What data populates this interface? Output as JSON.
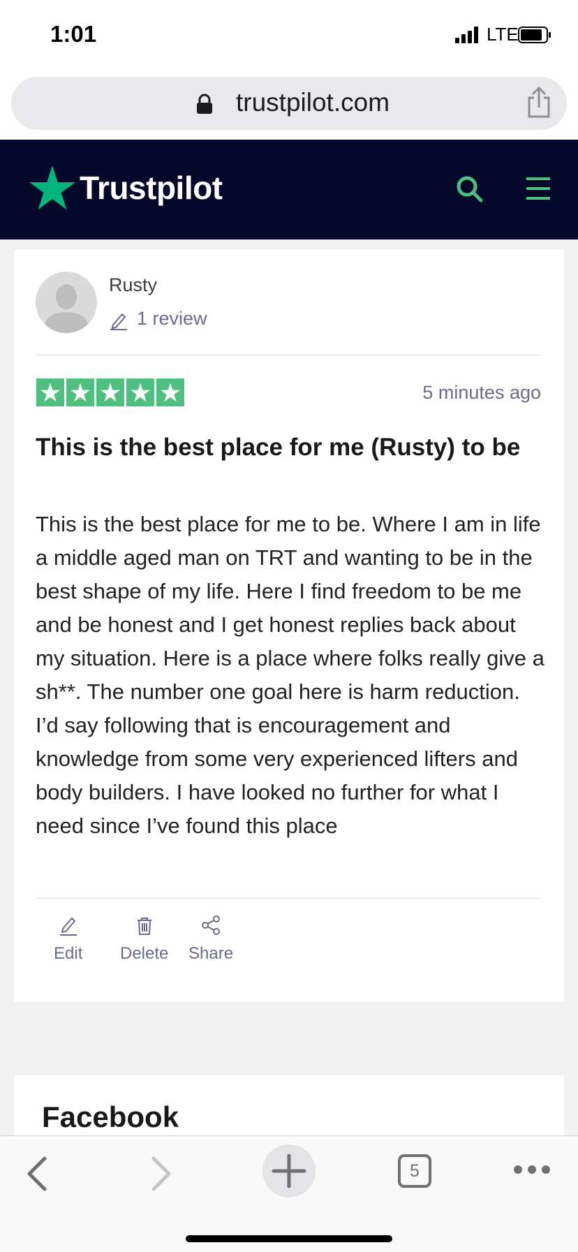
{
  "status_bar": {
    "time": "1:01",
    "network": "LTE"
  },
  "browser": {
    "domain": "trustpilot.com",
    "tab_count": "5"
  },
  "header": {
    "brand": "Trustpilot",
    "brand_color": "#04092a",
    "accent_color": "#00b67a"
  },
  "review": {
    "reviewer_name": "Rusty",
    "review_count": "1 review",
    "rating": 5,
    "time_ago": "5 minutes ago",
    "title": "This is the best place for me (Rusty) to be",
    "body": "This is the best place for me to be. Where I am in life a middle aged man on TRT and wanting to be in the best shape of my life. Here I find freedom to be me and be honest and I get honest replies back about my situation. Here is a place where folks really give a sh**. The number one goal here is harm reduction. I’d say following that is encouragement and knowledge from some very experienced lifters and body builders. I have looked no further for what I need since I’ve found this place",
    "actions": {
      "edit": "Edit",
      "delete": "Delete",
      "share": "Share"
    }
  },
  "next_card": {
    "title": "Facebook"
  },
  "icons": [
    "lock-icon",
    "share-icon",
    "trustpilot-star-icon",
    "search-icon",
    "menu-icon",
    "pencil-icon",
    "trash-icon",
    "share-nodes-icon",
    "back-icon",
    "forward-icon",
    "plus-icon",
    "more-icon"
  ]
}
